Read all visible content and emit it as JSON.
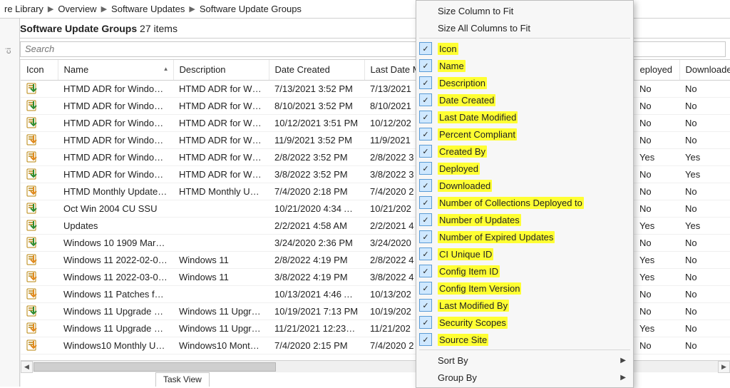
{
  "breadcrumb": {
    "segments": [
      "re Library",
      "Overview",
      "Software Updates",
      "Software Update Groups"
    ]
  },
  "header": {
    "title": "Software Update Groups",
    "count_label": "27 items"
  },
  "search": {
    "placeholder": "Search"
  },
  "columns": {
    "icon": "Icon",
    "name": "Name",
    "description": "Description",
    "date_created": "Date Created",
    "last_date": "Last Date M",
    "deployed": "eployed",
    "downloaded": "Downloaded"
  },
  "rows": [
    {
      "name": "HTMD ADR for Window…",
      "desc": "HTMD ADR for Wi…",
      "created": "7/13/2021 3:52 PM",
      "last": "7/13/2021",
      "dep": "No",
      "down": "No",
      "svg": "green"
    },
    {
      "name": "HTMD ADR for Window…",
      "desc": "HTMD ADR for Wi…",
      "created": "8/10/2021 3:52 PM",
      "last": "8/10/2021",
      "dep": "No",
      "down": "No",
      "svg": "green"
    },
    {
      "name": "HTMD ADR for Window…",
      "desc": "HTMD ADR for Wi…",
      "created": "10/12/2021 3:51 PM",
      "last": "10/12/202",
      "dep": "No",
      "down": "No",
      "svg": "green"
    },
    {
      "name": "HTMD ADR for Window…",
      "desc": "HTMD ADR for Wi…",
      "created": "11/9/2021 3:52 PM",
      "last": "11/9/2021",
      "dep": "No",
      "down": "No",
      "svg": "orange"
    },
    {
      "name": "HTMD ADR for Window…",
      "desc": "HTMD ADR for Wi…",
      "created": "2/8/2022 3:52 PM",
      "last": "2/8/2022 3",
      "dep": "Yes",
      "down": "Yes",
      "svg": "orange"
    },
    {
      "name": "HTMD ADR for Window…",
      "desc": "HTMD ADR for Wi…",
      "created": "3/8/2022 3:52 PM",
      "last": "3/8/2022 3",
      "dep": "No",
      "down": "Yes",
      "svg": "green"
    },
    {
      "name": "HTMD Monthly Updates…",
      "desc": "HTMD Monthly U…",
      "created": "7/4/2020 2:18 PM",
      "last": "7/4/2020 2",
      "dep": "No",
      "down": "No",
      "svg": "orange"
    },
    {
      "name": "Oct Win 2004 CU SSU",
      "desc": "",
      "created": "10/21/2020 4:34 A…",
      "last": "10/21/202",
      "dep": "No",
      "down": "No",
      "svg": "green"
    },
    {
      "name": "Updates",
      "desc": "",
      "created": "2/2/2021 4:58 AM",
      "last": "2/2/2021 4",
      "dep": "Yes",
      "down": "Yes",
      "svg": "green"
    },
    {
      "name": "Windows 10 1909 Marc…",
      "desc": "",
      "created": "3/24/2020 2:36 PM",
      "last": "3/24/2020",
      "dep": "No",
      "down": "No",
      "svg": "green"
    },
    {
      "name": "Windows 11 2022-02-0…",
      "desc": "Windows 11",
      "created": "2/8/2022 4:19 PM",
      "last": "2/8/2022 4",
      "dep": "Yes",
      "down": "No",
      "svg": "orange"
    },
    {
      "name": "Windows 11 2022-03-0…",
      "desc": "Windows 11",
      "created": "3/8/2022 4:19 PM",
      "last": "3/8/2022 4",
      "dep": "Yes",
      "down": "No",
      "svg": "orange"
    },
    {
      "name": "Windows 11 Patches for…",
      "desc": "",
      "created": "10/13/2021 4:46 A…",
      "last": "10/13/202",
      "dep": "No",
      "down": "No",
      "svg": "orange"
    },
    {
      "name": "Windows 11 Upgrade S…",
      "desc": "Windows 11 Upgr…",
      "created": "10/19/2021 7:13 PM",
      "last": "10/19/202",
      "dep": "No",
      "down": "No",
      "svg": "green"
    },
    {
      "name": "Windows 11 Upgrade S…",
      "desc": "Windows 11 Upgr…",
      "created": "11/21/2021 12:23…",
      "last": "11/21/202",
      "dep": "Yes",
      "down": "No",
      "svg": "orange"
    },
    {
      "name": "Windows10  Monthly U…",
      "desc": "Windows10  Mont…",
      "created": "7/4/2020 2:15 PM",
      "last": "7/4/2020 2",
      "dep": "No",
      "down": "No",
      "svg": "orange"
    }
  ],
  "context_menu": {
    "size_column": "Size Column to Fit",
    "size_all": "Size All Columns to Fit",
    "columns": [
      "Icon",
      "Name",
      "Description",
      "Date Created",
      "Last Date Modified",
      "Percent Compliant",
      "Created By",
      "Deployed",
      "Downloaded",
      "Number of Collections Deployed to",
      "Number of Updates",
      "Number of Expired Updates",
      "CI Unique ID",
      "Config Item ID",
      "Config Item Version",
      "Last Modified By",
      "Security Scopes",
      "Source Site"
    ],
    "sort_by": "Sort By",
    "group_by": "Group By"
  },
  "bottom_tab": "Task View"
}
